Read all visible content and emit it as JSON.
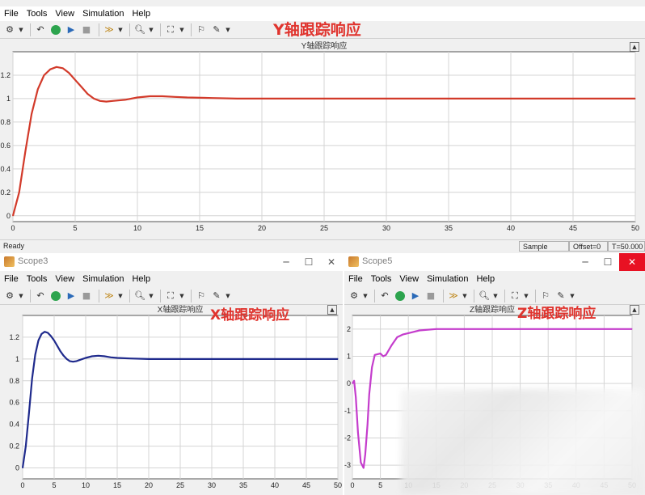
{
  "menu": [
    "File",
    "Tools",
    "View",
    "Simulation",
    "Help"
  ],
  "windows": {
    "top": {
      "annotation": "Y轴跟踪响应",
      "status": {
        "ready": "Ready",
        "sample": "Sample based",
        "offset": "Offset=0",
        "time": "T=50.000"
      }
    },
    "left": {
      "title": "Scope3",
      "annotation": "X轴跟踪响应"
    },
    "right": {
      "title": "Scope5",
      "annotation": "Z轴跟踪响应"
    }
  },
  "window_buttons": {
    "minimize": "─",
    "maximize": "☐",
    "close": "✕"
  },
  "chart_data": [
    {
      "type": "line",
      "title": "Y轴跟踪响应",
      "xlim": [
        0,
        50
      ],
      "ylim": [
        -0.05,
        1.4
      ],
      "xticks": [
        0,
        5,
        10,
        15,
        20,
        25,
        30,
        35,
        40,
        45,
        50
      ],
      "yticks": [
        0,
        0.2,
        0.4,
        0.6,
        0.8,
        1,
        1.2
      ],
      "ytick_labels": [
        "0",
        "0.2",
        "0.4",
        "0.6",
        "0.8",
        "1",
        "1.2"
      ],
      "grid": true,
      "series": [
        {
          "color": "#d23a2a",
          "x": [
            0,
            0.5,
            1,
            1.5,
            2,
            2.5,
            3,
            3.5,
            4,
            4.5,
            5,
            5.5,
            6,
            6.5,
            7,
            7.5,
            8,
            9,
            10,
            11,
            12,
            13,
            14,
            16,
            18,
            20,
            25,
            30,
            35,
            40,
            45,
            50
          ],
          "y": [
            0,
            0.2,
            0.55,
            0.87,
            1.08,
            1.2,
            1.25,
            1.27,
            1.26,
            1.22,
            1.16,
            1.1,
            1.04,
            1.0,
            0.98,
            0.975,
            0.98,
            0.99,
            1.01,
            1.02,
            1.02,
            1.015,
            1.01,
            1.005,
            1.0,
            1.0,
            1.0,
            1.0,
            1.0,
            1.0,
            1.0,
            1.0
          ]
        }
      ]
    },
    {
      "type": "line",
      "title": "X轴跟踪响应",
      "xlim": [
        0,
        50
      ],
      "ylim": [
        -0.1,
        1.4
      ],
      "xticks": [
        0,
        5,
        10,
        15,
        20,
        25,
        30,
        35,
        40,
        45,
        50
      ],
      "yticks": [
        0,
        0.2,
        0.4,
        0.6,
        0.8,
        1,
        1.2
      ],
      "ytick_labels": [
        "0",
        "0.2",
        "0.4",
        "0.6",
        "0.8",
        "1",
        "1.2"
      ],
      "grid": true,
      "series": [
        {
          "color": "#1f2a8c",
          "x": [
            0,
            0.5,
            1,
            1.5,
            2,
            2.5,
            3,
            3.5,
            4,
            4.5,
            5,
            5.5,
            6,
            6.5,
            7,
            7.5,
            8,
            8.5,
            9,
            10,
            11,
            12,
            13,
            14,
            15,
            17,
            20,
            25,
            30,
            35,
            40,
            45,
            50
          ],
          "y": [
            0,
            0.2,
            0.5,
            0.82,
            1.04,
            1.17,
            1.23,
            1.25,
            1.24,
            1.21,
            1.17,
            1.12,
            1.07,
            1.03,
            1.0,
            0.98,
            0.975,
            0.98,
            0.99,
            1.01,
            1.025,
            1.03,
            1.025,
            1.015,
            1.01,
            1.005,
            1.0,
            1.0,
            1.0,
            1.0,
            1.0,
            1.0,
            1.0
          ]
        }
      ]
    },
    {
      "type": "line",
      "title": "Z轴跟踪响应",
      "xlim": [
        0,
        50
      ],
      "ylim": [
        -3.5,
        2.5
      ],
      "xticks": [
        0,
        5,
        10,
        15,
        20,
        25,
        30,
        35,
        40,
        45,
        50
      ],
      "yticks": [
        -3,
        -2,
        -1,
        0,
        1,
        2
      ],
      "ytick_labels": [
        "-3",
        "-2",
        "-1",
        "0",
        "1",
        "2"
      ],
      "grid": true,
      "series": [
        {
          "color": "#c43ccc",
          "x": [
            0,
            0.3,
            0.6,
            1.0,
            1.5,
            2.0,
            2.3,
            2.7,
            3.0,
            3.5,
            4.0,
            5.0,
            5.5,
            6.0,
            7.0,
            8.0,
            9.0,
            10.0,
            12.0,
            15.0,
            20.0,
            25.0,
            30.0,
            35.0,
            40.0,
            45.0,
            50.0
          ],
          "y": [
            0,
            0.1,
            -0.5,
            -1.8,
            -2.9,
            -3.1,
            -2.6,
            -1.5,
            -0.4,
            0.6,
            1.05,
            1.1,
            1.0,
            1.05,
            1.4,
            1.7,
            1.8,
            1.85,
            1.95,
            2.0,
            2.0,
            2.0,
            2.0,
            2.0,
            2.0,
            2.0,
            2.0
          ]
        }
      ]
    }
  ]
}
